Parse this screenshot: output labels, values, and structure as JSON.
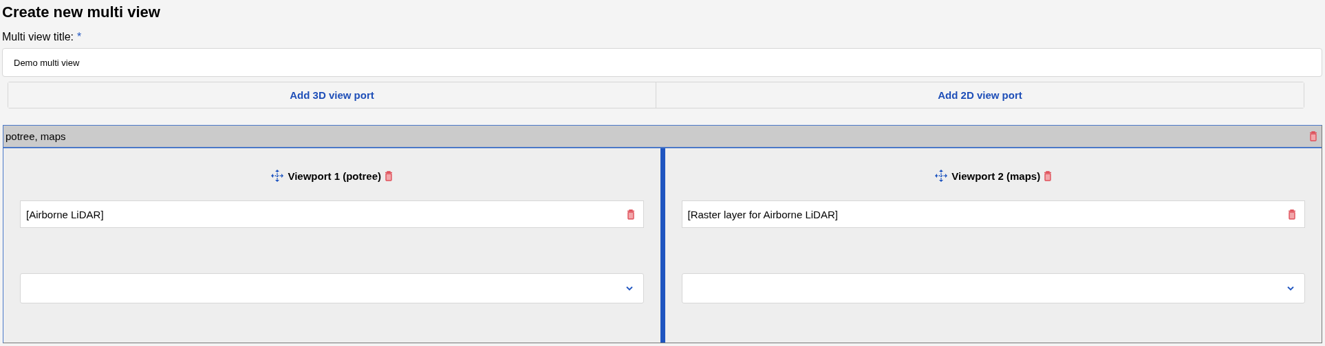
{
  "page": {
    "title": "Create new multi view"
  },
  "title_field": {
    "label": "Multi view title:",
    "required_mark": "*",
    "value": "Demo multi view"
  },
  "add_buttons": [
    "Add 3D view port",
    "Add 2D view port"
  ],
  "multi_view": {
    "header": "potree, maps",
    "viewports": [
      {
        "title": "Viewport 1 (potree)",
        "layers": [
          "[Airborne LiDAR]"
        ]
      },
      {
        "title": "Viewport 2 (maps)",
        "layers": [
          "[Raster layer for Airborne LiDAR]"
        ]
      }
    ]
  }
}
